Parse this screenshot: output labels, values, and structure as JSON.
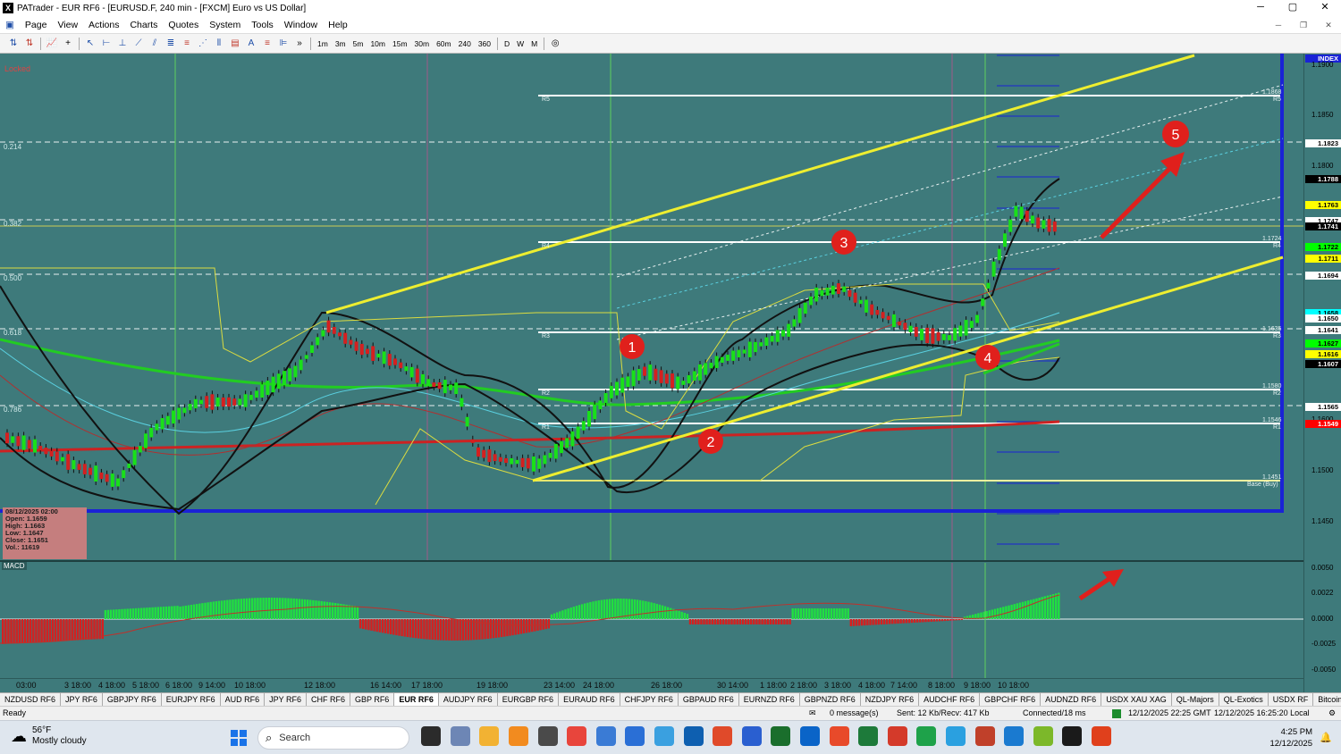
{
  "window": {
    "title": "PATrader - EUR RF6 - [EURUSD.F, 240 min - [FXCM] Euro vs US Dollar]",
    "buttons": [
      "─",
      "▢",
      "✕"
    ]
  },
  "menu": [
    "Page",
    "View",
    "Actions",
    "Charts",
    "Quotes",
    "System",
    "Tools",
    "Window",
    "Help"
  ],
  "toolbar": {
    "timeframes": [
      "1m",
      "3m",
      "5m",
      "10m",
      "15m",
      "30m",
      "60m",
      "240",
      "360",
      "D",
      "W",
      "M"
    ],
    "more": "»"
  },
  "chart": {
    "locked_label": "Locked",
    "fib_levels": [
      "0.214",
      "0.382",
      "0.500",
      "0.618",
      "0.786"
    ],
    "pivots": {
      "r5": "R5",
      "r4": "R4",
      "r3": "R3",
      "r2": "R2",
      "r1": "R1",
      "base": "Base (Buy)"
    },
    "pivot_values": {
      "r5": "1.1868",
      "r4": "1.1724",
      "r3": "1.1635",
      "r2": "1.1580",
      "r1": "1.1546",
      "base": "1.1451"
    },
    "ohlc": {
      "date": "08/12/2025 02:00",
      "open": "Open: 1.1659",
      "high": "High: 1.1663",
      "low": "Low: 1.1647",
      "close": "Close: 1.1651",
      "vol": "Vol.: 11619"
    },
    "annotations": [
      "1",
      "2",
      "3",
      "4",
      "5"
    ],
    "price_axis": {
      "index_label": "INDEX",
      "ticks": [
        "1.1900",
        "1.1850",
        "1.1800",
        "1.1750",
        "1.1700",
        "1.1650",
        "1.1600",
        "1.1550",
        "1.1500",
        "1.1450"
      ],
      "tags": [
        {
          "v": "1.1823",
          "bg": "#ffffff",
          "fg": "#000000"
        },
        {
          "v": "1.1788",
          "bg": "#000000",
          "fg": "#ffffff"
        },
        {
          "v": "1.1763",
          "bg": "#ffff00",
          "fg": "#000000"
        },
        {
          "v": "1.1747",
          "bg": "#ffffff",
          "fg": "#000000"
        },
        {
          "v": "1.1741",
          "bg": "#000000",
          "fg": "#ffffff"
        },
        {
          "v": "1.1722",
          "bg": "#00ff00",
          "fg": "#000000"
        },
        {
          "v": "1.1711",
          "bg": "#ffff00",
          "fg": "#000000"
        },
        {
          "v": "1.1694",
          "bg": "#ffffff",
          "fg": "#000000"
        },
        {
          "v": "1.1658",
          "bg": "#00ffff",
          "fg": "#000000"
        },
        {
          "v": "1.1650",
          "bg": "#ffffff",
          "fg": "#000000"
        },
        {
          "v": "1.1641",
          "bg": "#ffffff",
          "fg": "#000000"
        },
        {
          "v": "1.1627",
          "bg": "#00ff00",
          "fg": "#000000"
        },
        {
          "v": "1.1616",
          "bg": "#ffff00",
          "fg": "#000000"
        },
        {
          "v": "1.1607",
          "bg": "#000000",
          "fg": "#ffffff"
        },
        {
          "v": "1.1565",
          "bg": "#ffffff",
          "fg": "#000000"
        },
        {
          "v": "1.1549",
          "bg": "#ff0000",
          "fg": "#ffffff"
        }
      ]
    },
    "macd": {
      "label": "MACD",
      "ticks": [
        "0.0050",
        "0.0025",
        "0.0000",
        "-0.0025",
        "-0.0050"
      ],
      "value_tag": "0.0022"
    },
    "time_labels": [
      "03:00",
      "3 18:00",
      "4 18:00",
      "5 18:00",
      "6 18:00",
      "9 14:00",
      "10 18:00",
      "12 18:00",
      "16 14:00",
      "17 18:00",
      "19 18:00",
      "23 14:00",
      "24 18:00",
      "26 18:00",
      "30 14:00",
      "1 18:00",
      "2 18:00",
      "3 18:00",
      "4 18:00",
      "7 14:00",
      "8 18:00",
      "9 18:00",
      "10 18:00"
    ]
  },
  "tabs": [
    "NZDUSD RF6",
    "JPY RF6",
    "GBPJPY RF6",
    "EURJPY RF6",
    "AUD RF6",
    "JPY RF6",
    "CHF RF6",
    "GBP RF6",
    "EUR RF6",
    "AUDJPY RF6",
    "EURGBP RF6",
    "EURAUD RF6",
    "CHFJPY RF6",
    "GBPAUD RF6",
    "EURNZD RF6",
    "GBPNZD RF6",
    "NZDJPY RF6",
    "AUDCHF RF6",
    "GBPCHF RF6",
    "AUDNZD RF6",
    "USDX XAU XAG",
    "QL-Majors",
    "QL-Exotics",
    "USDX RF",
    "Bitcoin",
    "Lyte",
    "SP500"
  ],
  "active_tab": "EUR RF6",
  "status": {
    "ready": "Ready",
    "messages": "0 message(s)",
    "traffic": "Sent: 12 Kb/Recv: 417 Kb",
    "connected": "Connected/18 ms",
    "gmt": "12/12/2025 22:25 GMT",
    "local": "12/12/2025 16:25:20 Local"
  },
  "taskbar": {
    "temp": "56°F",
    "weather": "Mostly cloudy",
    "search_placeholder": "Search",
    "time": "4:25 PM",
    "date": "12/12/2025"
  }
}
